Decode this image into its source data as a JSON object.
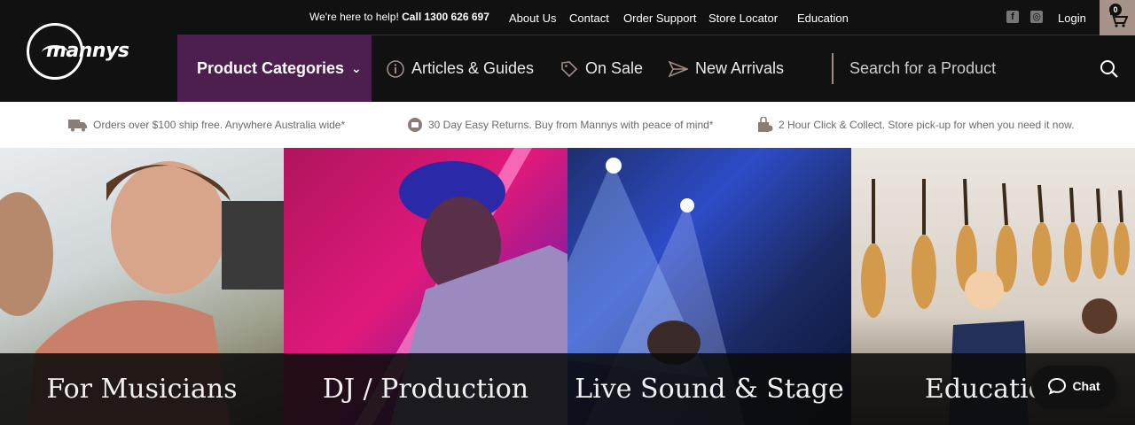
{
  "brand": {
    "logo_text": "mannys"
  },
  "topbar": {
    "help_prefix": "We're here to help!",
    "help_phone": "Call 1300 626 697",
    "links": [
      "About Us",
      "Contact",
      "Order Support",
      "Store Locator",
      "Education"
    ],
    "login": "Login",
    "cart_count": "0"
  },
  "nav": {
    "categories": "Product Categories",
    "articles": "Articles & Guides",
    "sale": "On Sale",
    "arrivals": "New Arrivals",
    "search_placeholder": "Search for a Product"
  },
  "perks": [
    "Orders over $100 ship free. Anywhere Australia wide*",
    "30 Day Easy Returns. Buy from Mannys with peace of mind*",
    "2 Hour Click & Collect. Store pick-up for when you need it now."
  ],
  "tiles": [
    "For Musicians",
    "DJ / Production",
    "Live Sound & Stage",
    "Education"
  ],
  "chat": {
    "label": "Chat"
  },
  "colors": {
    "accent_purple": "#4d1f4e",
    "header_bg": "#111111",
    "cart_bg": "#a8938a"
  }
}
